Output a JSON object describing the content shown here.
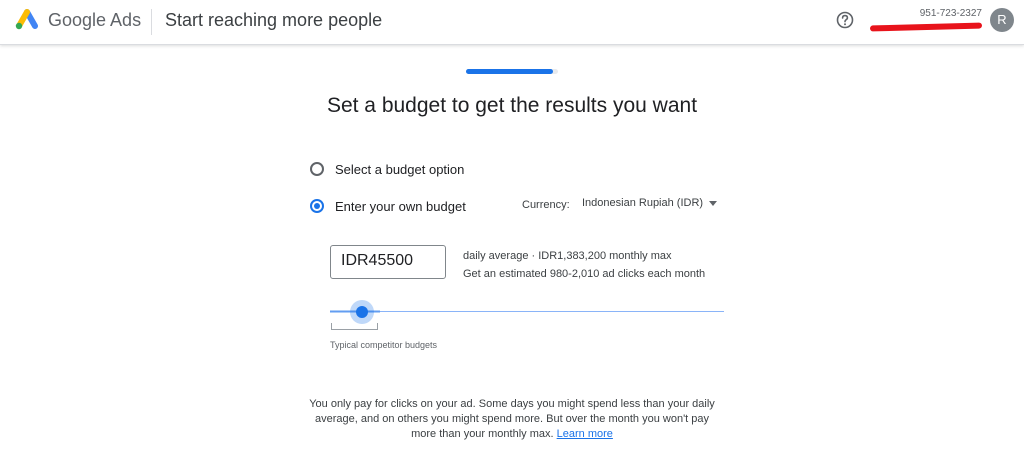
{
  "header": {
    "brand": "Google Ads",
    "title": "Start reaching more people",
    "account_phone": "951-723-2327",
    "avatar_initial": "R"
  },
  "progress": {
    "fraction": 0.95
  },
  "main": {
    "heading": "Set a budget to get the results you want",
    "option_preset_label": "Select a budget option",
    "option_custom_label": "Enter your own budget",
    "selected_option": "custom",
    "currency_label": "Currency:",
    "currency_value": "Indonesian Rupiah (IDR)",
    "budget_value": "IDR45500",
    "daily_info": "daily average  ·  IDR1,383,200 monthly max",
    "clicks_info": "Get an estimated 980-2,010 ad clicks each month",
    "slider_label": "Typical competitor budgets"
  },
  "footer": {
    "line1": "You only pay for clicks on your ad. Some days you might spend less than your daily",
    "line2": "average, and on others you might spend more. But over the month you won't pay",
    "line3": "more than your monthly max.",
    "learn_more": "Learn more"
  },
  "colors": {
    "accent": "#1a73e8",
    "redaction": "#e8131b"
  },
  "icons": {
    "logo": "google-ads-logo",
    "help": "help-circle-icon",
    "caret": "caret-down-icon"
  }
}
